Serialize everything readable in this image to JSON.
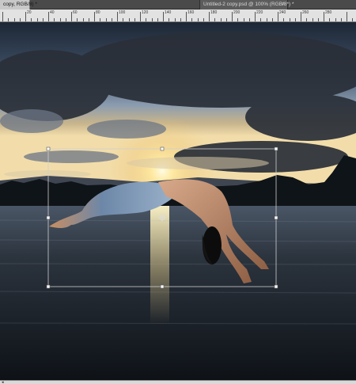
{
  "tabs": {
    "active_label": "copy, RGB/8) *",
    "inactive_label": "Untitled-2 copy.psd @ 100% (RGB/8*) *",
    "close_glyph": "×"
  },
  "ruler": {
    "labels": [
      "20",
      "40",
      "60",
      "80",
      "100",
      "120",
      "140",
      "160",
      "180",
      "200",
      "220",
      "240",
      "260",
      "280"
    ]
  },
  "canvas": {
    "image_alt": "sunset lake with a diving figure with a fish tail, under free-transform"
  },
  "status": {
    "arrow_glyph": "◂"
  },
  "colors": {
    "sky_top": "#1f2b3a",
    "sky_mid": "#5b6f88",
    "horizon_glow": "#fff6c9",
    "water": "#1b2027",
    "transform_box": "#c9c9c9"
  }
}
